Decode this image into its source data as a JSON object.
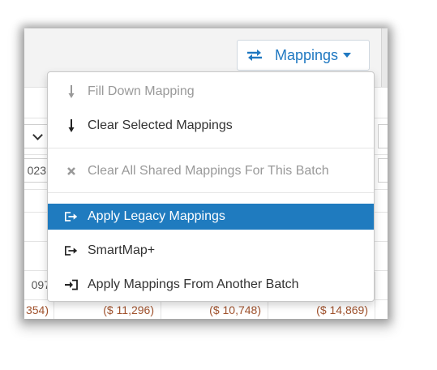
{
  "toolbar": {
    "mappings_label": "Mappings"
  },
  "background_grid": {
    "date_fragment": "023",
    "number_fragment": "097",
    "negatives": [
      "354)",
      "($ 11,296)",
      "($ 10,748)",
      "($ 14,869)"
    ]
  },
  "menu": {
    "items": [
      {
        "label": "Fill Down Mapping",
        "icon": "arrow-down-icon",
        "state": "disabled"
      },
      {
        "label": "Clear Selected Mappings",
        "icon": "arrow-down-icon",
        "state": "normal"
      },
      {
        "label": "Clear All Shared Mappings For This Batch",
        "icon": "times-icon",
        "state": "disabled"
      },
      {
        "label": "Apply Legacy Mappings",
        "icon": "sign-out-icon",
        "state": "highlighted"
      },
      {
        "label": "SmartMap+",
        "icon": "sign-out-icon",
        "state": "normal"
      },
      {
        "label": "Apply Mappings From Another Batch",
        "icon": "sign-in-icon",
        "state": "normal"
      }
    ]
  },
  "colors": {
    "accent": "#1f78c1",
    "highlight": "#1f7bbf",
    "disabled_text": "#999999",
    "negative_text": "#a0522d"
  }
}
